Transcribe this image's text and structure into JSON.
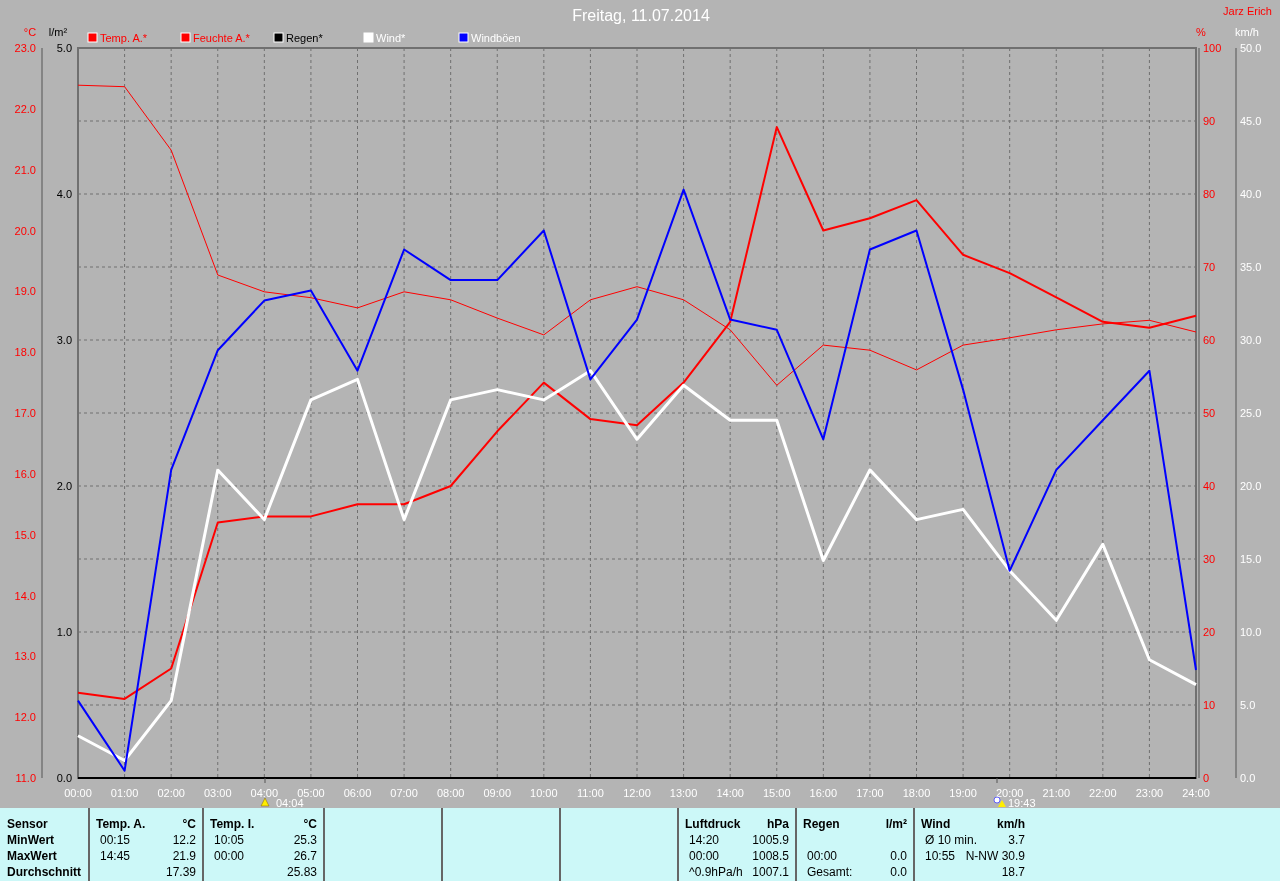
{
  "title": "Freitag, 11.07.2014",
  "author": "Jarz Erich",
  "chart": {
    "rain_axis": {
      "label": "l/m²",
      "ticks": [
        "5.0",
        "4.0",
        "3.0",
        "2.0",
        "1.0",
        "0.0"
      ]
    },
    "chart_data": {
      "type": "line",
      "grid": true,
      "legend": "top",
      "x": [
        "00:00",
        "01:00",
        "02:00",
        "03:00",
        "04:00",
        "05:00",
        "06:00",
        "07:00",
        "08:00",
        "09:00",
        "10:00",
        "11:00",
        "12:00",
        "13:00",
        "14:00",
        "15:00",
        "16:00",
        "17:00",
        "18:00",
        "19:00",
        "20:00",
        "21:00",
        "22:00",
        "23:00",
        "24:00"
      ],
      "ylabel": "°C",
      "ylim": [
        11,
        23
      ],
      "yticks": [
        {
          "value": 11,
          "label": "11.0"
        },
        {
          "value": 12,
          "label": "12.0"
        },
        {
          "value": 13,
          "label": "13.0"
        },
        {
          "value": 14,
          "label": "14.0"
        },
        {
          "value": 15,
          "label": "15.0"
        },
        {
          "value": 16,
          "label": "16.0"
        },
        {
          "value": 17,
          "label": "17.0"
        },
        {
          "value": 18,
          "label": "18.0"
        },
        {
          "value": 19,
          "label": "19.0"
        },
        {
          "value": 20,
          "label": "20.0"
        },
        {
          "value": 21,
          "label": "21.0"
        },
        {
          "value": 22,
          "label": "22.0"
        },
        {
          "value": 23,
          "label": "23.0"
        }
      ],
      "y2label": "%",
      "y2lim": [
        0,
        100
      ],
      "y2ticks": [
        0,
        10,
        20,
        30,
        40,
        50,
        60,
        70,
        80,
        90,
        100
      ],
      "y3label": "km/h",
      "y3lim": [
        0,
        50
      ],
      "y3ticks": [
        {
          "value": 0,
          "label": "0.0"
        },
        {
          "value": 5,
          "label": "5.0"
        },
        {
          "value": 10,
          "label": "10.0"
        },
        {
          "value": 15,
          "label": "15.0"
        },
        {
          "value": 20,
          "label": "20.0"
        },
        {
          "value": 25,
          "label": "25.0"
        },
        {
          "value": 30,
          "label": "30.0"
        },
        {
          "value": 35,
          "label": "35.0"
        },
        {
          "value": 40,
          "label": "40.0"
        },
        {
          "value": 45,
          "label": "45.0"
        },
        {
          "value": 50,
          "label": "50.0"
        }
      ],
      "series": [
        {
          "name": "Temp. A.*",
          "color": "#ff0000",
          "values": [
            12.4,
            12.3,
            12.8,
            15.2,
            15.3,
            15.3,
            15.5,
            15.5,
            15.8,
            16.7,
            17.5,
            16.9,
            16.8,
            17.5,
            18.5,
            21.7,
            20.0,
            20.2,
            20.5,
            19.6,
            19.3,
            18.9,
            18.5,
            18.4,
            18.6
          ]
        },
        {
          "name": "Feuchte A.*",
          "color": "#ff0000",
          "axis": "y2",
          "values": [
            94.9,
            94.7,
            86.0,
            68.9,
            66.6,
            65.8,
            64.4,
            66.6,
            65.5,
            63.0,
            60.7,
            65.5,
            67.3,
            65.5,
            61.4,
            53.8,
            59.3,
            58.6,
            55.9,
            59.3,
            60.3,
            61.4,
            62.2,
            62.7,
            61.1
          ]
        },
        {
          "name": "Regen*",
          "color": "#000000",
          "axis": "y2",
          "values": [
            0,
            0,
            0,
            0,
            0,
            0,
            0,
            0,
            0,
            0,
            0,
            0,
            0,
            0,
            0,
            0,
            0,
            0,
            0,
            0,
            0,
            0,
            0,
            0,
            0
          ]
        },
        {
          "name": "Wind*",
          "color": "#ffffff",
          "axis": "y3",
          "values": [
            2.9,
            1.2,
            5.3,
            21.1,
            17.7,
            25.9,
            27.3,
            17.7,
            25.9,
            26.6,
            25.9,
            27.9,
            23.2,
            26.9,
            24.5,
            24.5,
            14.9,
            21.1,
            17.7,
            18.4,
            14.2,
            10.8,
            16.0,
            8.1,
            6.4
          ]
        },
        {
          "name": "Windböen",
          "color": "#0000ff",
          "axis": "y3",
          "values": [
            5.3,
            0.5,
            21.1,
            29.3,
            32.7,
            33.4,
            27.9,
            36.2,
            34.1,
            34.1,
            37.5,
            27.3,
            31.4,
            40.3,
            31.4,
            30.7,
            23.2,
            36.2,
            37.5,
            26.6,
            14.2,
            21.1,
            24.5,
            27.9,
            7.4
          ]
        }
      ],
      "annotations": [
        "04:04",
        "19:43"
      ]
    }
  },
  "table": {
    "panels": [
      {
        "kind": "labels",
        "items": [
          "Sensor",
          "MinWert",
          "MaxWert",
          "Durchschnitt"
        ]
      },
      {
        "kind": "data",
        "title": "Temp. A.",
        "unit": "°C",
        "rows": [
          {
            "time": "00:15",
            "value": "12.2"
          },
          {
            "time": "14:45",
            "value": "21.9"
          },
          {
            "value": "17.39"
          }
        ]
      },
      {
        "kind": "data",
        "title": "Temp. I.",
        "unit": "°C",
        "rows": [
          {
            "time": "10:05",
            "value": "25.3"
          },
          {
            "time": "00:00",
            "value": "26.7"
          },
          {
            "value": "25.83"
          }
        ]
      },
      {
        "kind": "empty"
      },
      {
        "kind": "empty"
      },
      {
        "kind": "empty"
      },
      {
        "kind": "data",
        "title": "Luftdruck",
        "unit": "hPa",
        "rows": [
          {
            "time": "14:20",
            "value": "1005.9"
          },
          {
            "time": "00:00",
            "value": "1008.5"
          },
          {
            "time": "^0.9hPa/h",
            "value": "1007.1"
          }
        ]
      },
      {
        "kind": "data",
        "title": "Regen",
        "unit": "l/m²",
        "rows": [
          {},
          {
            "time": "00:00",
            "value": "0.0"
          },
          {
            "time": "Gesamt:",
            "value": "0.0"
          }
        ]
      },
      {
        "kind": "data",
        "title": "Wind",
        "unit": "km/h",
        "rows": [
          {
            "time": "Ø 10 min.",
            "value": "3.7"
          },
          {
            "time": "10:55",
            "value": "N-NW 30.9"
          },
          {
            "value": "18.7"
          }
        ]
      }
    ]
  }
}
